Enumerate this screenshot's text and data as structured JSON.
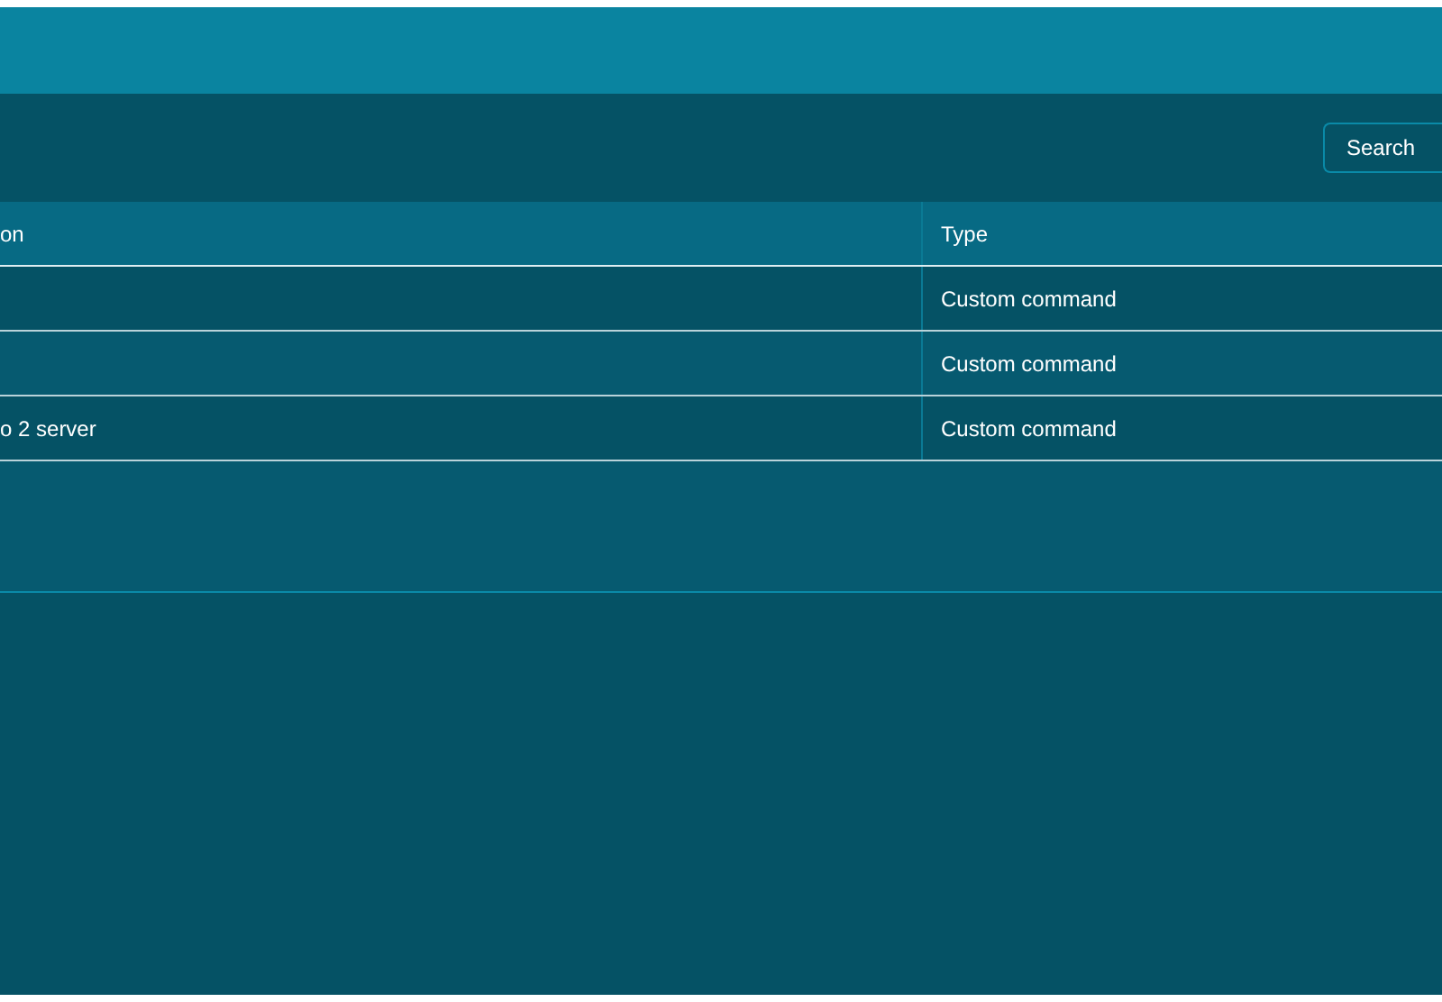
{
  "toolbar": {
    "search_button": "Search"
  },
  "table": {
    "columns": [
      "on",
      "Type"
    ],
    "rows": [
      {
        "type": "Custom command"
      },
      {
        "type": "Custom command"
      },
      {
        "column_1": "o 2 server",
        "type": "Custom command"
      }
    ]
  }
}
